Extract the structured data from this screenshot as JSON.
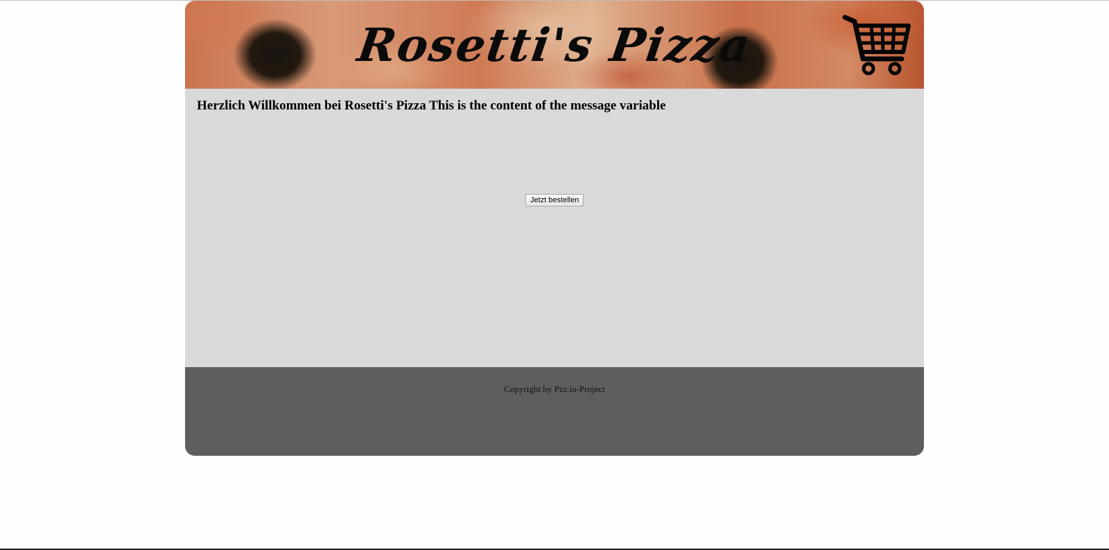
{
  "header": {
    "logo_text": "Rosetti's Pizza",
    "cart_icon": "shopping-cart-icon"
  },
  "main": {
    "welcome_text": "Herzlich Willkommen bei Rosetti's Pizza This is the content of the message variable",
    "order_button_label": "Jetzt bestellen",
    "background_color": "#d9d9d9"
  },
  "footer": {
    "copyright_text": "Copyright by Pzz.io-Project",
    "background_color": "#5e5e5e"
  }
}
